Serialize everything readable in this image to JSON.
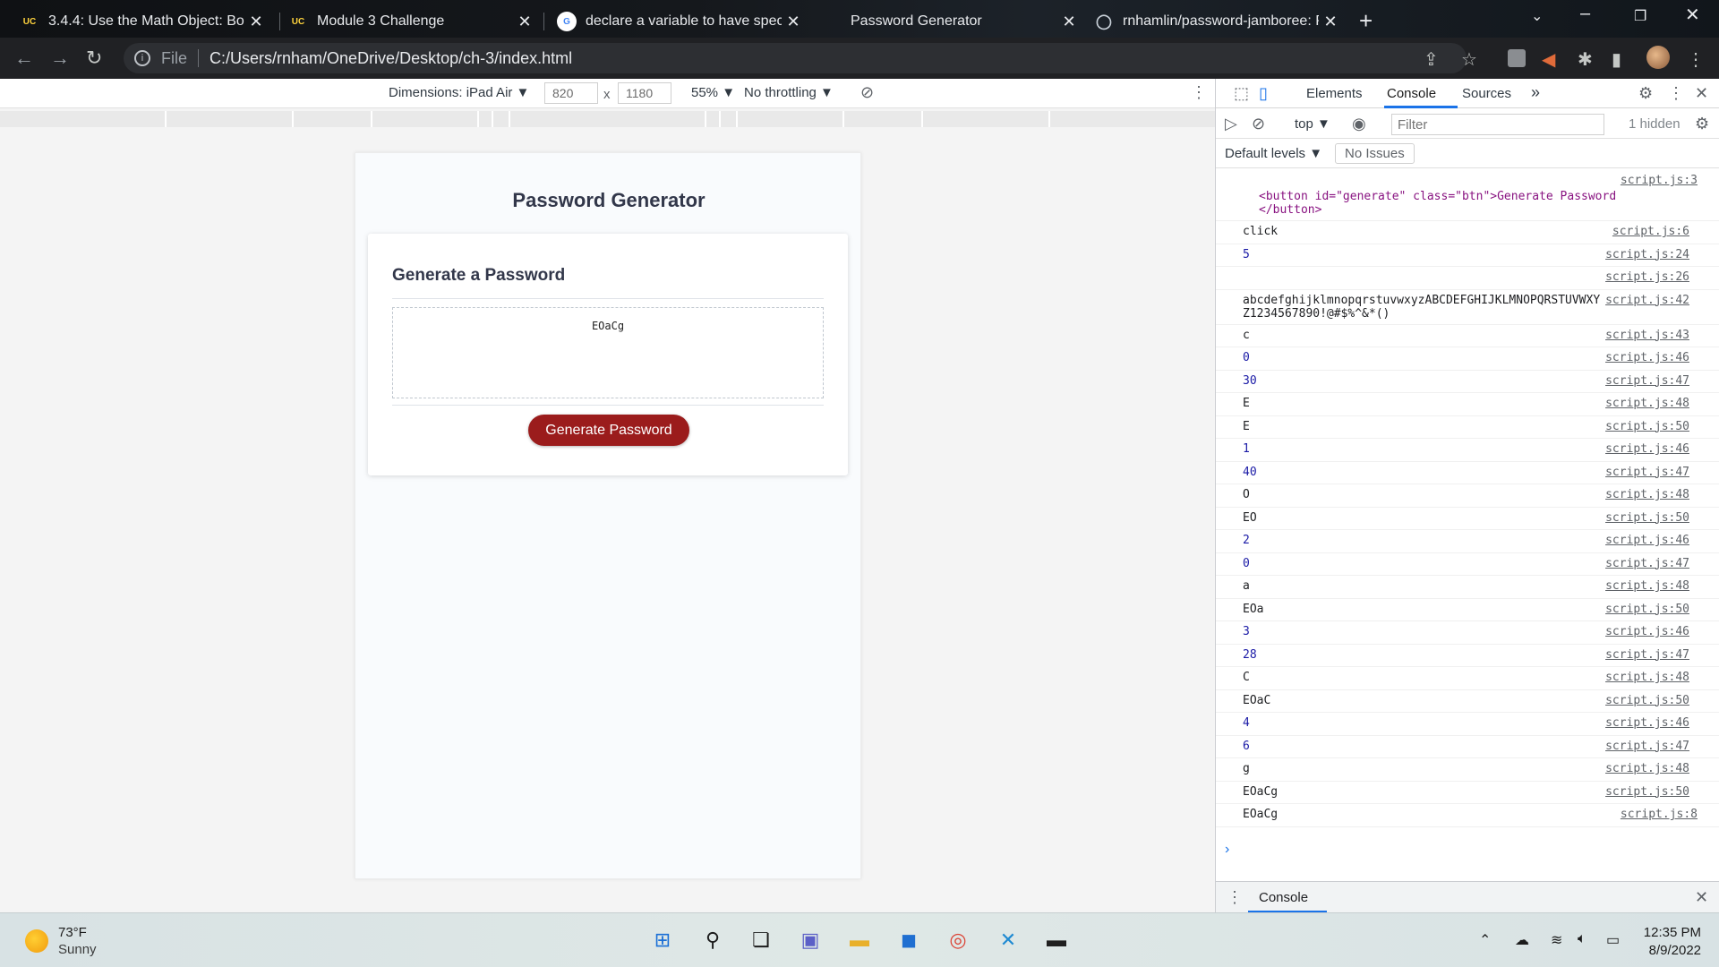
{
  "browser": {
    "tabs": [
      {
        "favicon": "UC",
        "title": "3.4.4: Use the Math Object: Boot",
        "close": "✕"
      },
      {
        "favicon": "UC",
        "title": "Module 3 Challenge",
        "close": "✕"
      },
      {
        "favicon": "G",
        "title": "declare a variable to have special",
        "close": "✕"
      },
      {
        "favicon": "",
        "title": "Password Generator",
        "close": "✕"
      },
      {
        "favicon": "",
        "title": "rnhamlin/password-jamboree: Pa",
        "close": "✕"
      }
    ],
    "address_scheme": "File",
    "address_url": "C:/Users/rnham/OneDrive/Desktop/ch-3/index.html"
  },
  "device_toolbar": {
    "dimensions_label": "Dimensions: iPad Air ▼",
    "width": "820",
    "times": "x",
    "height": "1180",
    "zoom": "55% ▼",
    "throttling": "No throttling ▼"
  },
  "page": {
    "title": "Password Generator",
    "card_title": "Generate a Password",
    "password": "EOaCg",
    "button_label": "Generate Password"
  },
  "devtools": {
    "tabs": [
      "Elements",
      "Console",
      "Sources"
    ],
    "active_tab": "Console",
    "more": "»",
    "context": "top ▼",
    "filter_placeholder": "Filter",
    "hidden": "1 hidden",
    "levels": "Default levels ▼",
    "issues": "No Issues",
    "drawer_tab": "Console",
    "console_prompt": "›",
    "logs": [
      {
        "msg": "",
        "src": "script.js:3",
        "type": "text"
      },
      {
        "msg": "click",
        "src": "script.js:6",
        "type": "text"
      },
      {
        "msg": "5",
        "src": "script.js:24",
        "type": "num"
      },
      {
        "msg": "",
        "src": "script.js:26",
        "type": "text"
      },
      {
        "msg": "abcdefghijklmnopqrstuvwxyzABCDEFGHIJKLMNOPQRSTUVWXYZ1234567890!@#$%^&*()",
        "src": "script.js:42",
        "type": "text"
      },
      {
        "msg": "c",
        "src": "script.js:43",
        "type": "text"
      },
      {
        "msg": "0",
        "src": "script.js:46",
        "type": "num"
      },
      {
        "msg": "30",
        "src": "script.js:47",
        "type": "num"
      },
      {
        "msg": "E",
        "src": "script.js:48",
        "type": "text"
      },
      {
        "msg": "E",
        "src": "script.js:50",
        "type": "text"
      },
      {
        "msg": "1",
        "src": "script.js:46",
        "type": "num"
      },
      {
        "msg": "40",
        "src": "script.js:47",
        "type": "num"
      },
      {
        "msg": "O",
        "src": "script.js:48",
        "type": "text"
      },
      {
        "msg": "EO",
        "src": "script.js:50",
        "type": "text"
      },
      {
        "msg": "2",
        "src": "script.js:46",
        "type": "num"
      },
      {
        "msg": "0",
        "src": "script.js:47",
        "type": "num"
      },
      {
        "msg": "a",
        "src": "script.js:48",
        "type": "text"
      },
      {
        "msg": "EOa",
        "src": "script.js:50",
        "type": "text"
      },
      {
        "msg": "3",
        "src": "script.js:46",
        "type": "num"
      },
      {
        "msg": "28",
        "src": "script.js:47",
        "type": "num"
      },
      {
        "msg": "C",
        "src": "script.js:48",
        "type": "text"
      },
      {
        "msg": "EOaC",
        "src": "script.js:50",
        "type": "text"
      },
      {
        "msg": "4",
        "src": "script.js:46",
        "type": "num"
      },
      {
        "msg": "6",
        "src": "script.js:47",
        "type": "num"
      },
      {
        "msg": "g",
        "src": "script.js:48",
        "type": "text"
      },
      {
        "msg": "EOaCg",
        "src": "script.js:50",
        "type": "text"
      },
      {
        "msg": "EOaCg",
        "src": "script.js:8",
        "type": "text"
      }
    ],
    "element_log": {
      "open": "<button id=\"generate\" class=\"btn\">Generate Password",
      "close": "</button>"
    }
  },
  "taskbar": {
    "temperature": "73°F",
    "condition": "Sunny",
    "time": "12:35 PM",
    "date": "8/9/2022"
  }
}
